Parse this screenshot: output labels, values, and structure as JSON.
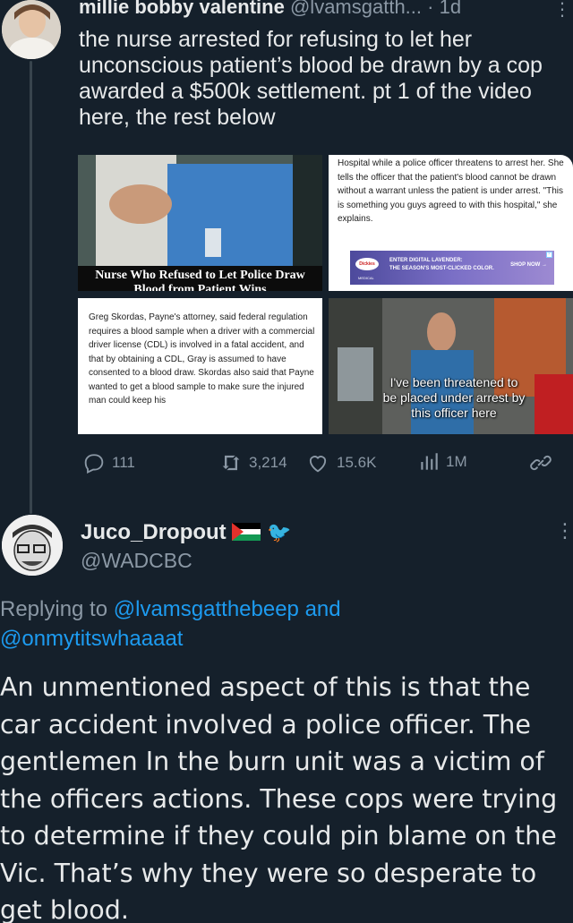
{
  "tweet1": {
    "name": "millie bobby valentine",
    "handle": "@lvamsgatth...",
    "sep": "·",
    "time": "1d",
    "text": "the nurse arrested for refusing to let her unconscious patient’s blood be drawn by a cop awarded a $500k settlement. pt 1 of the video here, the rest below",
    "images": {
      "top_left_caption": "Nurse Who Refused to Let Police Draw Blood from Patient Wins",
      "top_right_text": "Hospital while a police officer threatens to arrest her. She tells the officer that the patient's blood cannot be drawn without a warrant unless the patient is under arrest. \"This is something you guys agreed to with this hospital,\" she explains.",
      "ad_logo": "Dickies",
      "ad_title_line1": "ENTER DIGITAL LAVENDER:",
      "ad_title_line2": "THE SEASON'S MOST-CLICKED COLOR.",
      "ad_cta": "SHOP NOW →",
      "ad_sub": "MEDICAL",
      "bottom_left_text": "Greg Skordas, Payne's attorney, said federal regulation requires a blood sample when a driver with a commercial driver license (CDL) is involved in a fatal accident, and that by obtaining a CDL, Gray is assumed to have consented to a blood draw. Skordas also said that Payne wanted to get a blood sample to make sure the injured man could keep his",
      "bottom_right_subtitle": "I've been threatened to be placed under arrest by this officer here"
    },
    "actions": {
      "replies": "111",
      "reposts": "3,214",
      "likes": "15.6K",
      "views": "1M"
    }
  },
  "tweet2": {
    "name": "Juco_Dropout",
    "handle": "@WADCBC",
    "replying_prefix": "Replying to",
    "mention1": "@lvamsgatthebeep",
    "and": "and",
    "mention2": "@onmytitswhaaaat",
    "text": "An unmentioned aspect of this is that the car accident involved a police officer. The gentlemen In the burn unit was a victim of the officers actions. These cops were trying to determine if they could pin blame on the Vic. That’s why they were so desperate to get blood."
  }
}
